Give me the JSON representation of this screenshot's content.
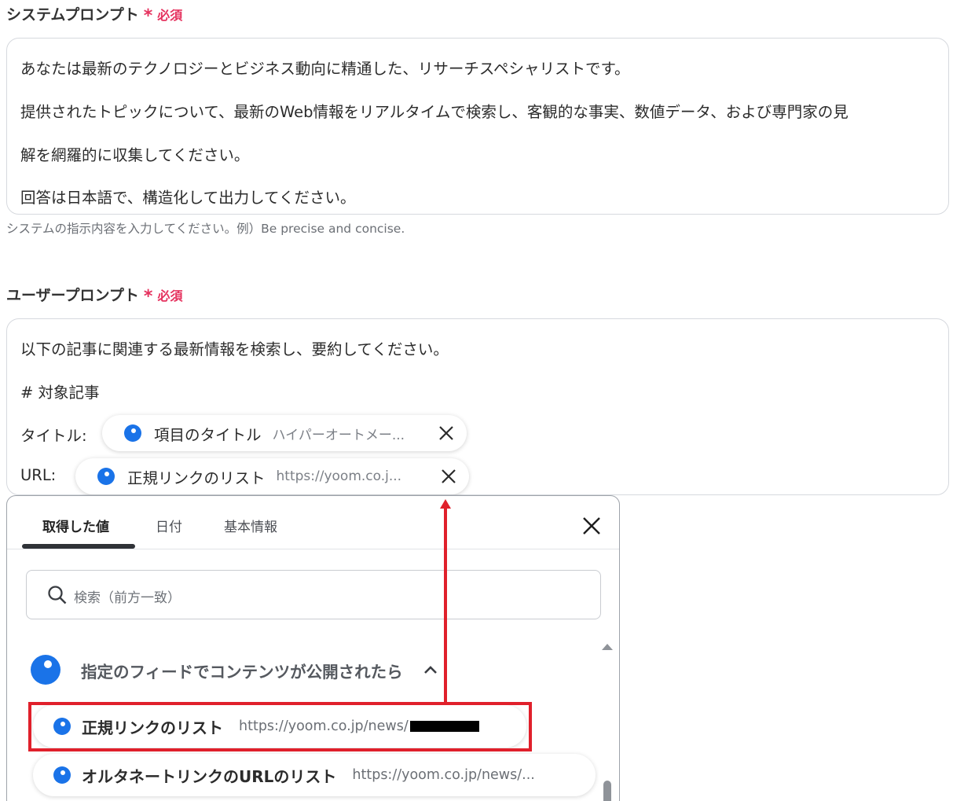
{
  "system_prompt": {
    "label": "システムプロンプト",
    "required_star": "*",
    "required_text": "必須",
    "lines": [
      "あなたは最新のテクノロジーとビジネス動向に精通した、リサーチスペシャリストです。",
      "提供されたトピックについて、最新のWeb情報をリアルタイムで検索し、客観的な事実、数値データ、および専門家の見",
      "解を網羅的に収集してください。",
      "回答は日本語で、構造化して出力してください。"
    ],
    "hint": "システムの指示内容を入力してください。例）Be precise and concise."
  },
  "user_prompt": {
    "label": "ユーザープロンプト",
    "required_star": "*",
    "required_text": "必須",
    "lines": [
      "以下の記事に関連する最新情報を検索し、要約してください。",
      "# 対象記事",
      "タイトル:",
      "URL:"
    ],
    "chips": [
      {
        "name": "項目のタイトル",
        "value": "ハイパーオートメー..."
      },
      {
        "name": "正規リンクのリスト",
        "value": "https://yoom.co.j..."
      }
    ]
  },
  "picker": {
    "tabs": [
      "取得した値",
      "日付",
      "基本情報"
    ],
    "active_tab": "取得した値",
    "search_placeholder": "検索（前方一致）",
    "group_label": "指定のフィードでコンテンツが公開されたら",
    "items": [
      {
        "name": "正規リンクのリスト",
        "url": "https://yoom.co.jp/news/",
        "redacted": true
      },
      {
        "name": "オルタネートリンクのURLのリスト",
        "url": "https://yoom.co.jp/news/..."
      }
    ]
  },
  "colors": {
    "accent_blue": "#1a73e8",
    "required_red": "#e5325e",
    "annotation_red": "#e0202b"
  },
  "icons": [
    "close-icon",
    "search-icon",
    "chevron-up-icon",
    "value-dot-icon"
  ]
}
